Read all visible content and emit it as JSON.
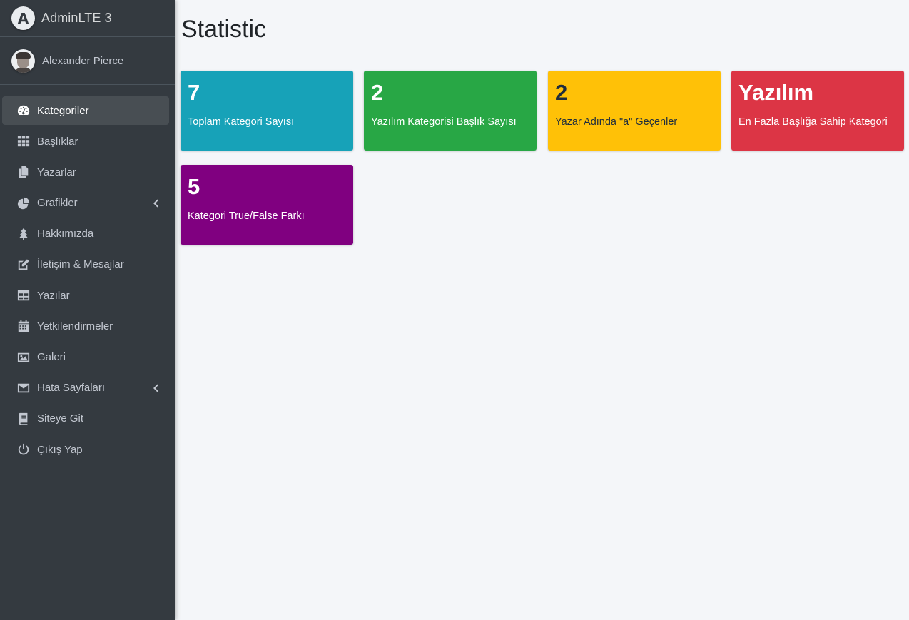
{
  "brand": {
    "logo_letter": "A",
    "name": "AdminLTE 3"
  },
  "user": {
    "name": "Alexander Pierce"
  },
  "nav": [
    {
      "label": "Kategoriler",
      "icon": "tachometer-icon",
      "active": true
    },
    {
      "label": "Başlıklar",
      "icon": "grid-icon"
    },
    {
      "label": "Yazarlar",
      "icon": "copy-icon"
    },
    {
      "label": "Grafikler",
      "icon": "pie-chart-icon",
      "has_arrow": true
    },
    {
      "label": "Hakkımızda",
      "icon": "tree-icon"
    },
    {
      "label": "İletişim & Mesajlar",
      "icon": "edit-icon"
    },
    {
      "label": "Yazılar",
      "icon": "table-icon"
    },
    {
      "label": "Yetkilendirmeler",
      "icon": "calendar-icon"
    },
    {
      "label": "Galeri",
      "icon": "image-icon"
    },
    {
      "label": "Hata Sayfaları",
      "icon": "envelope-icon",
      "has_arrow": true
    },
    {
      "label": "Siteye Git",
      "icon": "book-icon"
    },
    {
      "label": "Çıkış Yap",
      "icon": "power-icon"
    }
  ],
  "page": {
    "title": "Statistic"
  },
  "stats": [
    {
      "value": "7",
      "label": "Toplam Kategori Sayısı",
      "color": "#17a2b8"
    },
    {
      "value": "2",
      "label": "Yazılım Kategorisi Başlık Sayısı",
      "color": "#28a745"
    },
    {
      "value": "2",
      "label": "Yazar Adında \"a\" Geçenler",
      "color": "#ffc107"
    },
    {
      "value": "Yazılım",
      "label": "En Fazla Başlığa Sahip Kategori",
      "color": "#dc3545"
    },
    {
      "value": "5",
      "label": "Kategori True/False Farkı",
      "color": "#800080"
    }
  ]
}
